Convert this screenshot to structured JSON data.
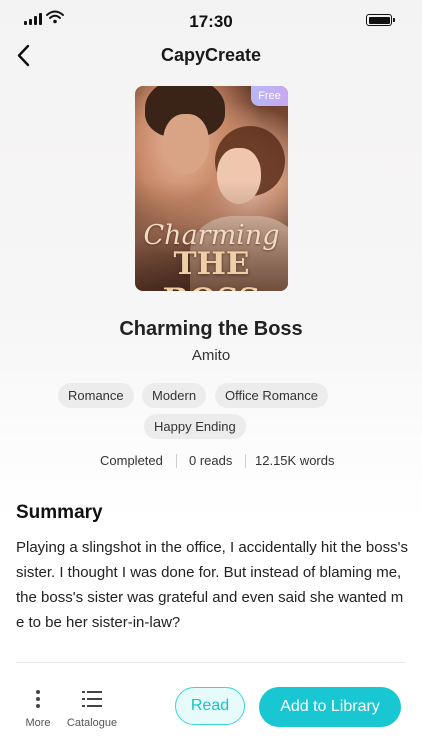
{
  "status_bar": {
    "time": "17:30"
  },
  "nav": {
    "title": "CapyCreate"
  },
  "book": {
    "cover_title_line1": "Charming",
    "cover_title_line2": "THE BOSS",
    "badge": "Free",
    "title": "Charming the Boss",
    "author": "Amito",
    "tags": [
      "Romance",
      "Modern",
      "Office Romance",
      "Happy Ending"
    ],
    "stats": {
      "status": "Completed",
      "reads": "0 reads",
      "words": "12.15K words"
    }
  },
  "summary": {
    "heading": "Summary",
    "text": "Playing a slingshot in the office, I accidentally hit the boss's sister. I thought I was done for. But instead of blaming me, the boss's sister was grateful and even said she wanted me to be her sister-in-law?"
  },
  "bottom_bar": {
    "more_label": "More",
    "catalogue_label": "Catalogue",
    "read_label": "Read",
    "add_label": "Add to Library"
  },
  "colors": {
    "accent": "#18c7d2",
    "read_bg": "#e8fbfb",
    "tag_bg": "#ececec",
    "badge_from": "#b7b7f5",
    "badge_to": "#c8a8f2"
  }
}
